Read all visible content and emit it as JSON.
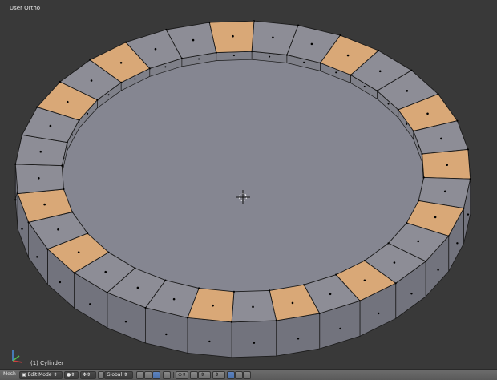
{
  "viewport": {
    "view_label": "User Ortho",
    "object_label": "(1) Cylinder",
    "colors": {
      "background": "#393939",
      "face": "#8d8d96",
      "face_selected": "#d9a877",
      "side": "#72737d",
      "inner_wall": "#7f8089",
      "cap": "#858691",
      "edge": "#1a1a1a",
      "vertex": "#000000"
    }
  },
  "header": {
    "menu_label": "Mesh",
    "mode": "Edit Mode",
    "pivot_icon": "pivot-point-icon",
    "orientation": "Global",
    "icons": [
      "editor-type-icon",
      "viewport-shading-icon",
      "snap-icon",
      "manipulator-icon",
      "translate-icon",
      "rotate-icon",
      "scale-icon",
      "layer-icon",
      "select-vertex-icon",
      "select-edge-icon",
      "select-face-icon",
      "limit-selection-icon",
      "proportional-edit-icon",
      "snap-magnet-icon",
      "snap-element-icon",
      "render-icon"
    ]
  }
}
